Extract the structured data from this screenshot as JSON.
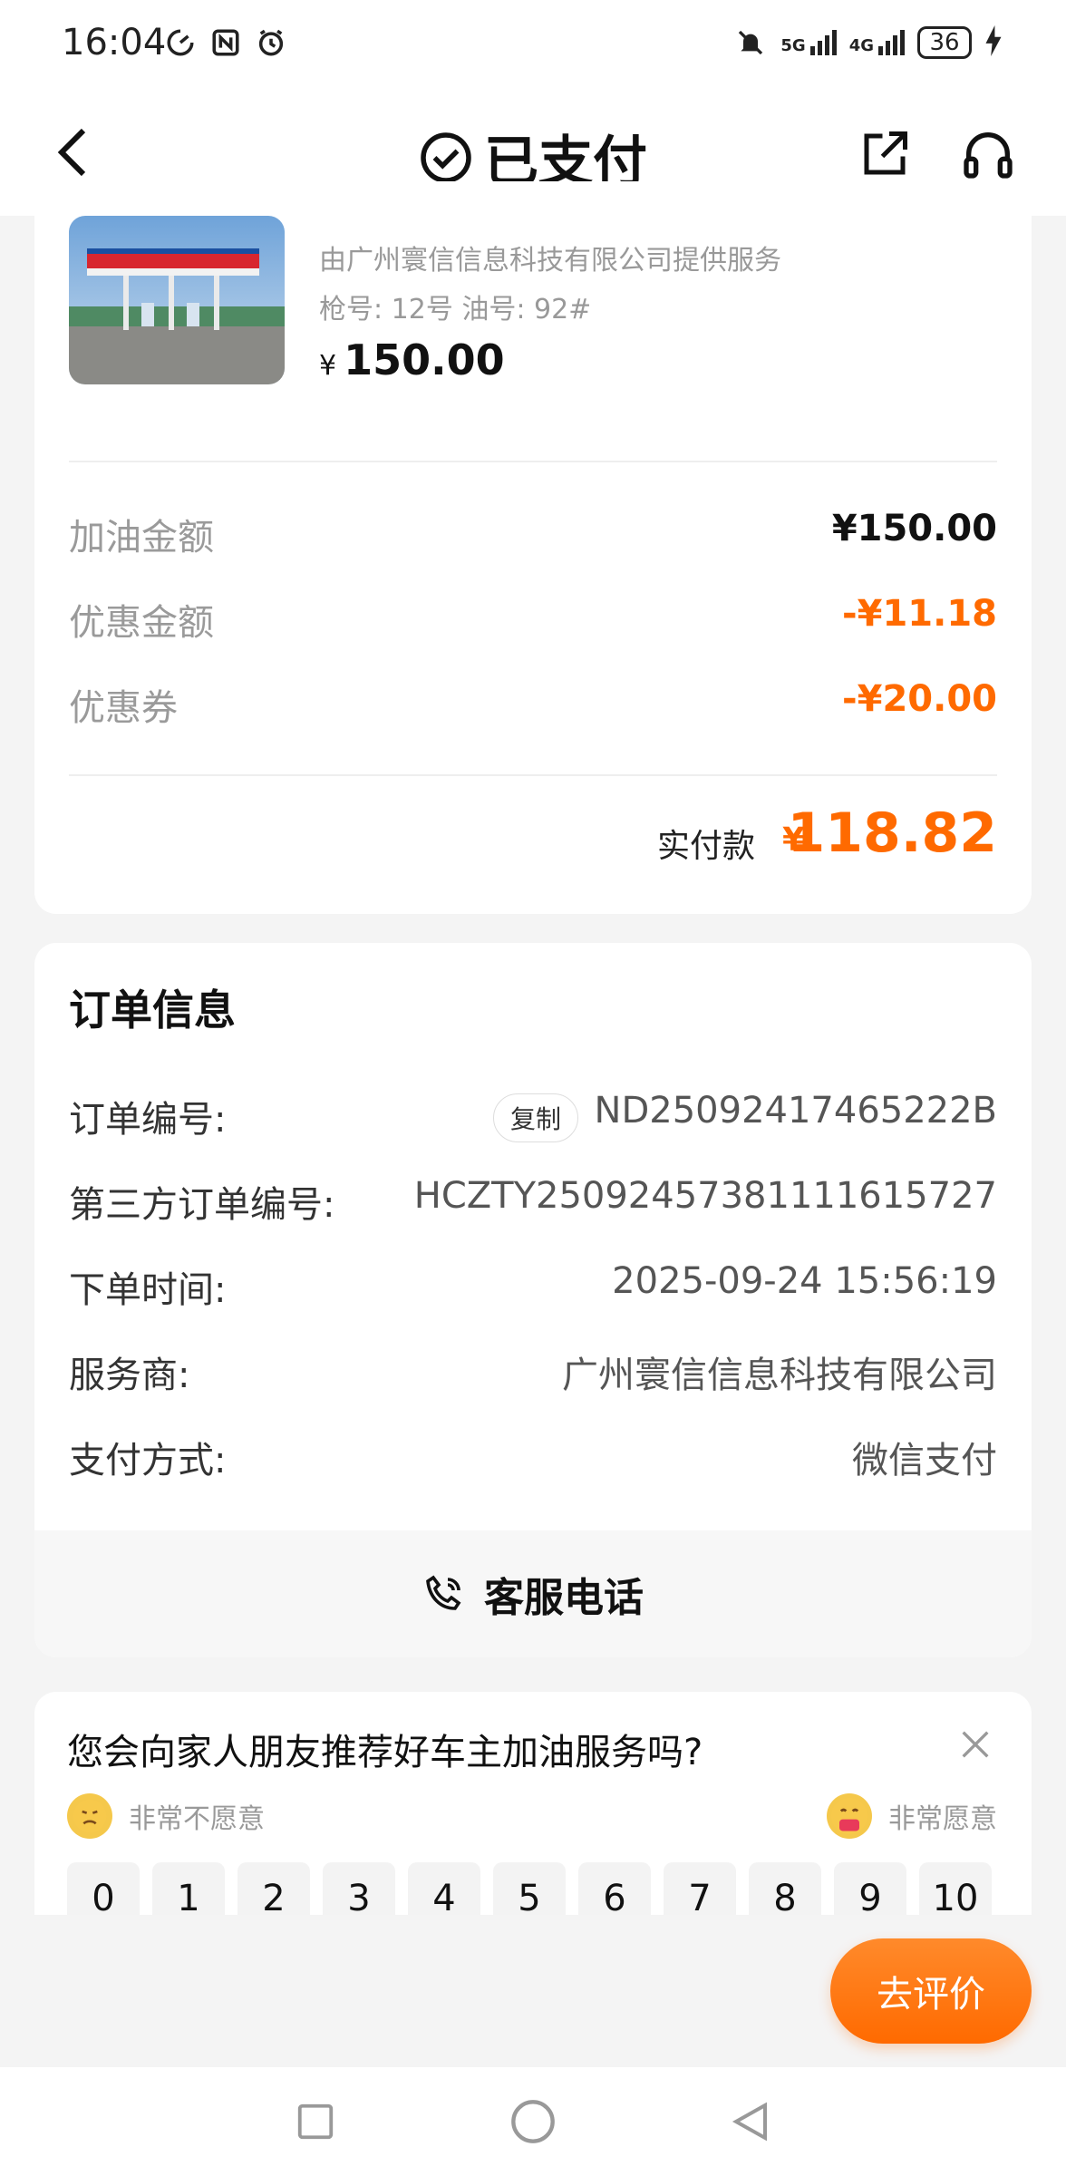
{
  "status_bar": {
    "time": "16:04",
    "icons_left": [
      "speed-icon",
      "nfc-icon",
      "alarm-icon"
    ],
    "network_5g": "5G",
    "network_4g": "4G",
    "battery": "36",
    "icons_right": [
      "mute-icon",
      "signal-5g-icon",
      "signal-4g-icon",
      "battery-icon",
      "charging-icon"
    ]
  },
  "nav": {
    "title": "已支付",
    "icons": [
      "back-icon",
      "check-circle-icon",
      "share-icon",
      "headset-icon"
    ]
  },
  "order_summary": {
    "provider": "由广州寰信信息科技有限公司提供服务",
    "gun_info": "枪号: 12号 油号: 92#",
    "currency_symbol": "¥",
    "price": "150.00",
    "rows": [
      {
        "label": "加油金额",
        "value": "¥150.00"
      },
      {
        "label": "优惠金额",
        "value": "-¥11.18"
      },
      {
        "label": "优惠券",
        "value": "-¥20.00"
      }
    ],
    "total_label": "实付款",
    "total_symbol": "¥",
    "total_value": "118.82",
    "accent_color": "#ff6a00"
  },
  "order_info": {
    "title": "订单信息",
    "copy_label": "复制",
    "items": [
      {
        "label": "订单编号:",
        "value": "ND25092417465222B"
      },
      {
        "label": "第三方订单编号:",
        "value": "HCZTY25092457381111615727"
      },
      {
        "label": "下单时间:",
        "value": "2025-09-24 15:56:19"
      },
      {
        "label": "服务商:",
        "value": "广州寰信信息科技有限公司"
      },
      {
        "label": "支付方式:",
        "value": "微信支付"
      }
    ],
    "service_label": "客服电话"
  },
  "survey": {
    "question": "您会向家人朋友推荐好车主加油服务吗?",
    "left_label": "非常不愿意",
    "right_label": "非常愿意",
    "scores": [
      "0",
      "1",
      "2",
      "3",
      "4",
      "5",
      "6",
      "7",
      "8",
      "9",
      "10"
    ]
  },
  "review_button": "去评价"
}
